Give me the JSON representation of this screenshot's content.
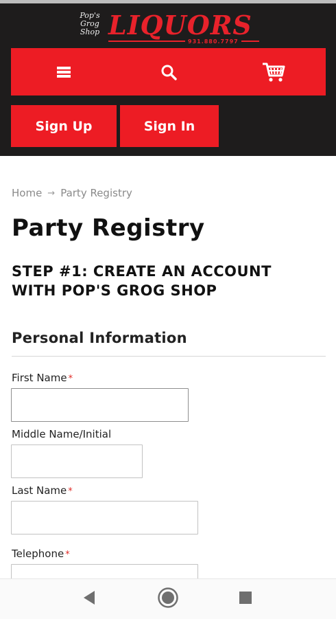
{
  "header": {
    "logo": {
      "script_text": "Pop's Grog Shop",
      "word": "LIQUORS",
      "phone": "931.880.7797"
    },
    "nav": {
      "menu_icon": "hamburger-menu-icon",
      "search_icon": "search-icon",
      "cart_icon": "shopping-cart-icon"
    },
    "auth": {
      "signup_label": "Sign Up",
      "signin_label": "Sign In"
    }
  },
  "breadcrumb": {
    "home": "Home",
    "separator": "→",
    "current": "Party Registry"
  },
  "page": {
    "title": "Party Registry",
    "step_title": "STEP #1: CREATE AN ACCOUNT WITH POP'S GROG SHOP",
    "section_title": "Personal Information"
  },
  "form": {
    "required_mark": "*",
    "first_name": {
      "label": "First Name",
      "value": ""
    },
    "middle_name": {
      "label": "Middle Name/Initial",
      "value": ""
    },
    "last_name": {
      "label": "Last Name",
      "value": ""
    },
    "telephone": {
      "label": "Telephone",
      "value": ""
    }
  },
  "system_nav": {
    "back_icon": "back-triangle-icon",
    "home_icon": "home-circle-icon",
    "recents_icon": "recents-square-icon"
  },
  "colors": {
    "header_bg": "#1e1c1c",
    "brand_red": "#ed1c24",
    "required_red": "#e02b27"
  }
}
